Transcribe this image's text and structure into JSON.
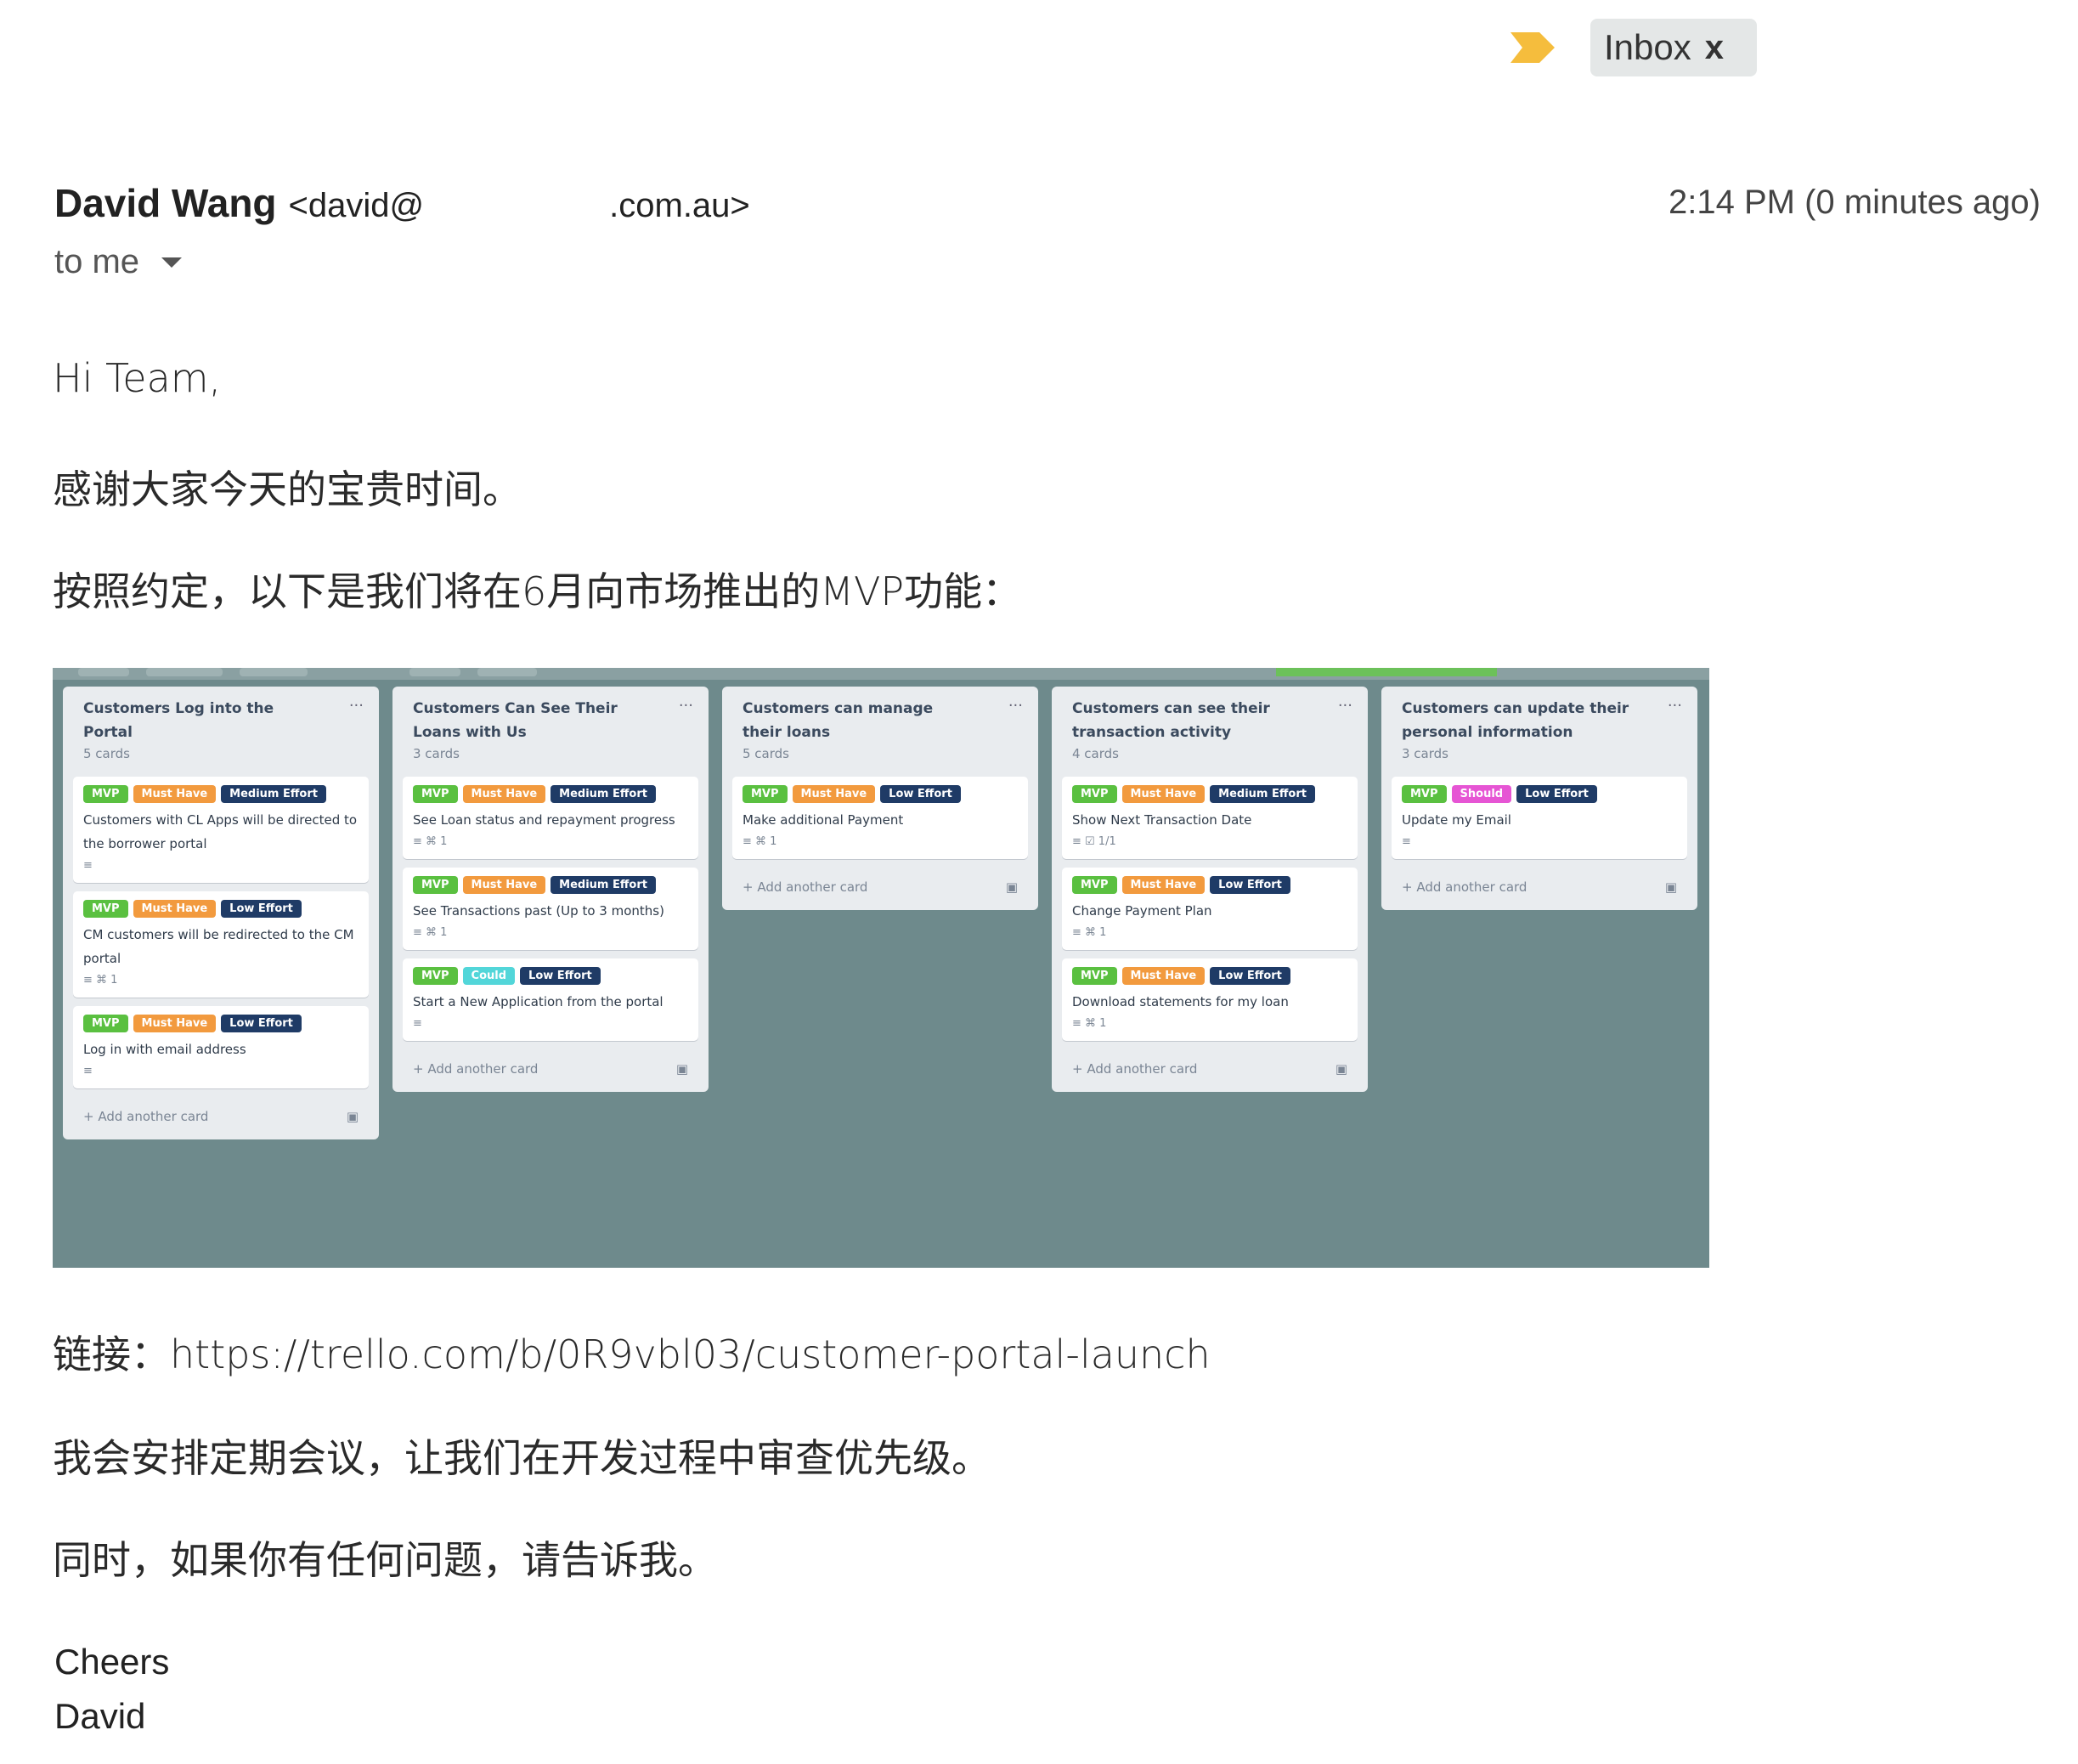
{
  "labels": {
    "inbox": "Inbox",
    "inbox_close": "x"
  },
  "header": {
    "sender_name": "David Wang",
    "sender_email_prefix": "<david@",
    "sender_email_suffix": ".com.au>",
    "timestamp": "2:14 PM (0 minutes ago)",
    "recipient": "to me"
  },
  "body": {
    "greeting": "Hi Team,",
    "line1": "感谢大家今天的宝贵时间。",
    "line2": "按照约定，以下是我们将在6月向市场推出的MVP功能：",
    "link_label": "链接：",
    "link_url": "https://trello.com/b/0R9vbl03/customer-portal-launch",
    "line3": "我会安排定期会议，让我们在开发过程中审查优先级。",
    "line4": "同时，如果你有任何问题，请告诉我。",
    "signoff": "Cheers",
    "signature": "David"
  },
  "board": {
    "add_card_label": "+ Add another card",
    "lists": [
      {
        "title": "Customers Log into the Portal",
        "count": "5 cards",
        "cards": [
          {
            "labels": [
              "MVP",
              "Must Have",
              "Medium Effort"
            ],
            "text": "Customers with CL Apps will be directed to the borrower portal",
            "meta": "≡"
          },
          {
            "labels": [
              "MVP",
              "Must Have",
              "Low Effort"
            ],
            "text": "CM customers will be redirected to the CM portal",
            "meta": "≡  ⌘ 1"
          },
          {
            "labels": [
              "MVP",
              "Must Have",
              "Low Effort"
            ],
            "text": "Log in with email address",
            "meta": "≡"
          }
        ]
      },
      {
        "title": "Customers Can See Their Loans with Us",
        "count": "3 cards",
        "cards": [
          {
            "labels": [
              "MVP",
              "Must Have",
              "Medium Effort"
            ],
            "text": "See Loan status and repayment progress",
            "meta": "≡  ⌘ 1"
          },
          {
            "labels": [
              "MVP",
              "Must Have",
              "Medium Effort"
            ],
            "text": "See Transactions past (Up to 3 months)",
            "meta": "≡  ⌘ 1"
          },
          {
            "labels": [
              "MVP",
              "Could",
              "Low Effort"
            ],
            "text": "Start a New Application from the portal",
            "meta": "≡"
          }
        ]
      },
      {
        "title": "Customers can manage their loans",
        "count": "5 cards",
        "cards": [
          {
            "labels": [
              "MVP",
              "Must Have",
              "Low Effort"
            ],
            "text": "Make additional Payment",
            "meta": "≡  ⌘ 1"
          }
        ]
      },
      {
        "title": "Customers can see their transaction activity",
        "count": "4 cards",
        "cards": [
          {
            "labels": [
              "MVP",
              "Must Have",
              "Medium Effort"
            ],
            "text": "Show Next Transaction Date",
            "meta": "≡  ☑ 1/1"
          },
          {
            "labels": [
              "MVP",
              "Must Have",
              "Low Effort"
            ],
            "text": "Change Payment Plan",
            "meta": "≡  ⌘ 1"
          },
          {
            "labels": [
              "MVP",
              "Must Have",
              "Low Effort"
            ],
            "text": "Download statements for my loan",
            "meta": "≡  ⌘ 1"
          }
        ]
      },
      {
        "title": "Customers can update their personal information",
        "count": "3 cards",
        "cards": [
          {
            "labels": [
              "MVP",
              "Should",
              "Low Effort"
            ],
            "text": "Update my Email",
            "meta": "≡"
          }
        ]
      }
    ]
  },
  "colors": {
    "board_bg": "#6e8a8c",
    "label_mvp": "#5ac040",
    "label_must_have": "#f29a3e",
    "label_effort": "#1f3b66",
    "label_could": "#52d6d9",
    "label_should": "#e655d4",
    "important_marker": "#f5bd3d"
  },
  "icons": [
    "important-marker-icon",
    "close-icon",
    "caret-down-icon",
    "list-menu-icon",
    "card-template-icon"
  ]
}
